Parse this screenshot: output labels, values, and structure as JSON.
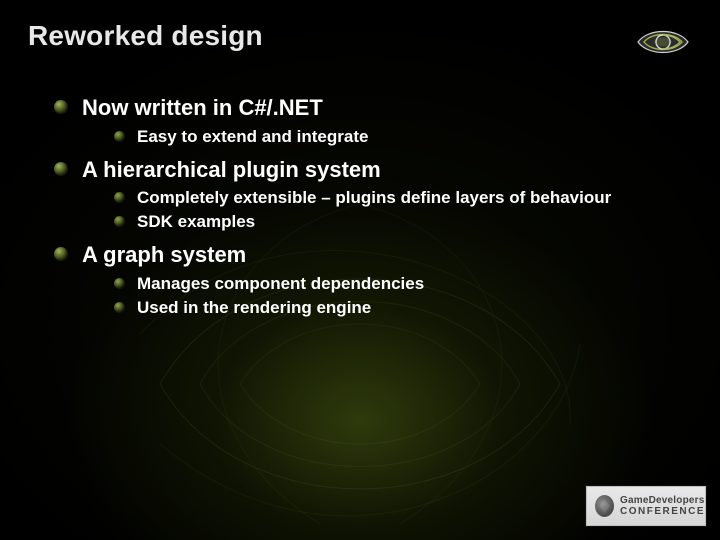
{
  "title": "Reworked design",
  "logo": {
    "name": "nvidia-eye-logo"
  },
  "bullets": [
    {
      "text": "Now written in C#/.NET",
      "children": [
        {
          "text": "Easy to extend and integrate"
        }
      ]
    },
    {
      "text": "A hierarchical plugin system",
      "children": [
        {
          "text": "Completely extensible – plugins define layers of behaviour"
        },
        {
          "text": "SDK examples"
        }
      ]
    },
    {
      "text": "A graph system",
      "children": [
        {
          "text": "Manages component dependencies"
        },
        {
          "text": "Used in the rendering engine"
        }
      ]
    }
  ],
  "footer_logo": {
    "line1": "GameDevelopers",
    "line2": "CONFERENCE"
  }
}
